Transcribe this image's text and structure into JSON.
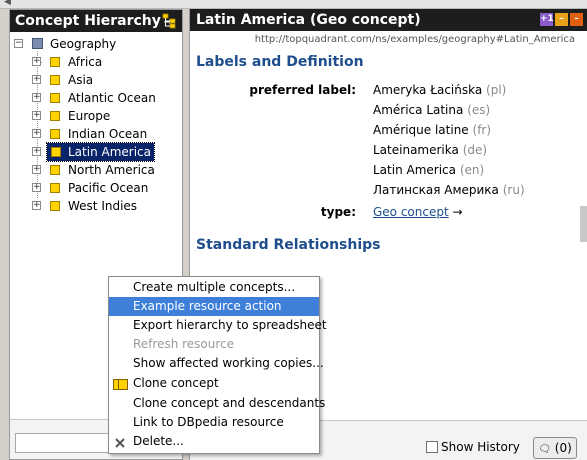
{
  "concept_panel": {
    "title": "Concept Hierarchy",
    "title_arrow": "→",
    "tree": {
      "root": "Geography",
      "children": [
        {
          "label": "Africa"
        },
        {
          "label": "Asia"
        },
        {
          "label": "Atlantic Ocean"
        },
        {
          "label": "Europe"
        },
        {
          "label": "Indian Ocean"
        },
        {
          "label": "Latin America",
          "selected": true
        },
        {
          "label": "North America"
        },
        {
          "label": "Pacific Ocean"
        },
        {
          "label": "West Indies"
        }
      ]
    }
  },
  "resource_panel": {
    "title": "Latin America (Geo concept)",
    "uri": "http://topquadrant.com/ns/examples/geography#Latin_America",
    "window_buttons": [
      "+1",
      "–",
      "–"
    ],
    "sections": {
      "labels": "Labels and Definition",
      "relationships": "Standard Relationships"
    },
    "preferred_label_name": "preferred label:",
    "preferred_labels": [
      {
        "text": "Ameryka Łacińska",
        "lang": "(pl)"
      },
      {
        "text": "América Latina",
        "lang": "(es)"
      },
      {
        "text": "Amérique latine",
        "lang": "(fr)"
      },
      {
        "text": "Lateinamerika",
        "lang": "(de)"
      },
      {
        "text": "Latin America",
        "lang": "(en)"
      },
      {
        "text": "Латинская Америка",
        "lang": "(ru)"
      }
    ],
    "type_name": "type:",
    "type_value": "Geo concept",
    "type_arrow": "→"
  },
  "footer": {
    "show_history": "Show History",
    "comments": "(0)"
  },
  "context_menu": {
    "items": [
      {
        "label": "Create multiple concepts..."
      },
      {
        "label": "Example resource action",
        "highlighted": true
      },
      {
        "label": "Export hierarchy to spreadsheet"
      },
      {
        "label": "Refresh resource",
        "disabled": true
      },
      {
        "label": "Show affected working copies..."
      },
      {
        "label": "Clone concept"
      },
      {
        "label": "Clone concept and descendants"
      },
      {
        "label": "Link to DBpedia resource"
      },
      {
        "label": "Delete..."
      }
    ]
  },
  "colors": {
    "header_bg": "#1d1d1d",
    "selection_bg": "#0a246a",
    "menu_highlight": "#3d7fd9",
    "section_blue": "#1f4e8c",
    "concept_yellow": "#ffd200"
  }
}
